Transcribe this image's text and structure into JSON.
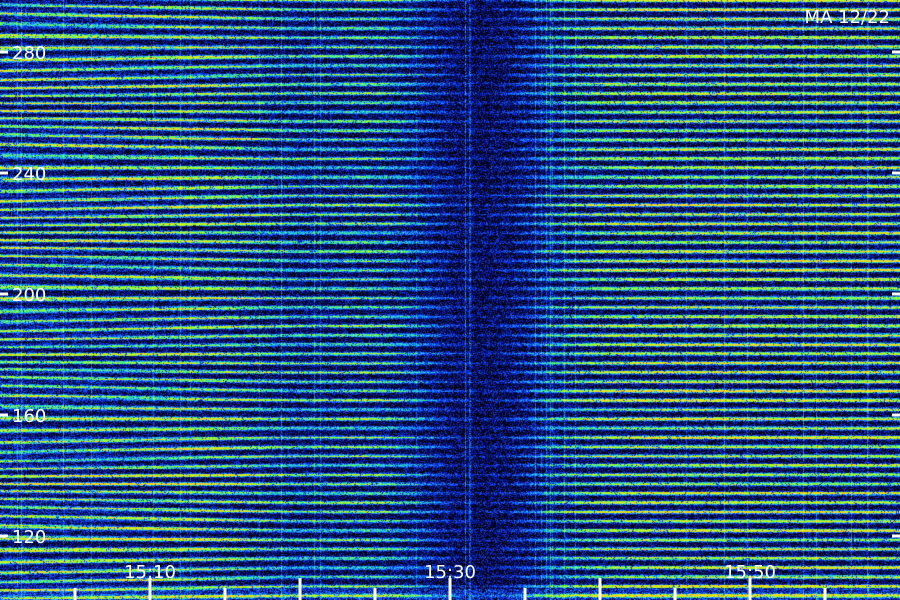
{
  "chart_data": {
    "type": "heatmap",
    "label": "MA 12/22",
    "y_ticks": [
      "120",
      "160",
      "200",
      "240",
      "280"
    ],
    "x_ticks": [
      "15:10",
      "15:30",
      "15:50"
    ],
    "colormap": [
      "#000010",
      "#0a1aa0",
      "#1450ff",
      "#1aa0ff",
      "#2ee0c0",
      "#7dff3a",
      "#c8ff1e",
      "#ffd21e"
    ],
    "background": "#000008"
  }
}
